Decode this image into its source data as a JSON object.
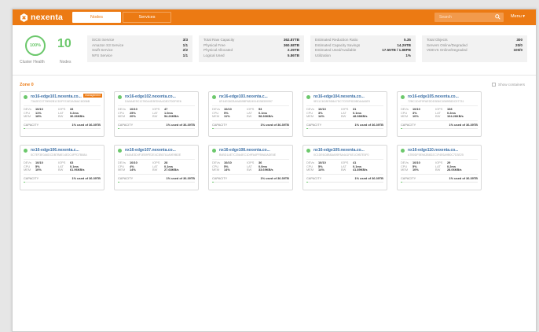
{
  "header": {
    "logo": "nexenta",
    "tabs": [
      {
        "label": "Nodes"
      },
      {
        "label": "Services"
      }
    ],
    "search_placeholder": "Search",
    "menu_label": "Menu ▾"
  },
  "summary": {
    "health_value": "100%",
    "health_label": "Cluster Health",
    "nodes_count": "10",
    "nodes_label": "Nodes",
    "services": [
      {
        "label": "iSCSI Service",
        "value": "3/3"
      },
      {
        "label": "Amazon S3 Service",
        "value": "1/1"
      },
      {
        "label": "Swift Service",
        "value": "2/2"
      },
      {
        "label": "NFS Service",
        "value": "1/1"
      }
    ],
    "capacity": [
      {
        "label": "Total Raw Capacity",
        "value": "362.87TB"
      },
      {
        "label": "Physical Free",
        "value": "360.58TB"
      },
      {
        "label": "Physical Allocated",
        "value": "2.29TB"
      },
      {
        "label": "Logical Used",
        "value": "5.86TB"
      }
    ],
    "efficiency": [
      {
        "label": "Estimated Reduction Ratio",
        "value": "5.35"
      },
      {
        "label": "Estimated Capacity Savings",
        "value": "14.29TB"
      },
      {
        "label": "Estimated Used/Available",
        "value": "17.55TB / 1.88PB"
      },
      {
        "label": "Utilization",
        "value": "1%"
      }
    ],
    "objects": [
      {
        "label": "Total Objects",
        "value": "300"
      },
      {
        "label": "Servers Online/Degraded",
        "value": "20/0"
      },
      {
        "label": "VDEVS Online/Degraded",
        "value": "100/0"
      }
    ]
  },
  "zone": {
    "title": "Zone 0",
    "show_containers_label": "Show containers"
  },
  "nodes": [
    {
      "name": "nx16-edge101.nexenta.co...",
      "id": "73A2EC3779B92B1CD2F07AE3A36AC8CB6B",
      "badge": "management",
      "devs": "10/10",
      "cpu": "11%",
      "mem": "18%",
      "iops": "33",
      "lat": "0.2ms",
      "bw": "36.36KB/s",
      "cap_label": "CAPACITY",
      "cap_value": "1% used of 36.39TB",
      "cap_pct": 1
    },
    {
      "name": "nx16-edge102.nexenta.co...",
      "id": "DA0A4E5C12780A4D3ED9A4C8D7DDF9E6",
      "badge": "",
      "devs": "10/10",
      "cpu": "25%",
      "mem": "20%",
      "iops": "47",
      "lat": "1.0ms",
      "bw": "54.26KB/s",
      "cap_label": "CAPACITY",
      "cap_value": "1% used of 36.39TB",
      "cap_pct": 1
    },
    {
      "name": "nx16-edge103.nexenta.c...",
      "id": "6F44E08CBA0AB9BF8824514D58300997",
      "badge": "",
      "devs": "10/10",
      "cpu": "5%",
      "mem": "11%",
      "iops": "53",
      "lat": "0.1ms",
      "bw": "58.36KB/s",
      "cap_label": "CAPACITY",
      "cap_value": "1% used of 36.39TB",
      "cap_pct": 1
    },
    {
      "name": "nx16-edge104.nexenta.co...",
      "id": "9E11C6C8E5D8A7DC7CE0F9D0BDA4A6E9",
      "badge": "",
      "devs": "10/10",
      "cpu": "3%",
      "mem": "14%",
      "iops": "31",
      "lat": "0.1ms",
      "bw": "48.98KB/s",
      "cap_label": "CAPACITY",
      "cap_value": "1% used of 36.39TB",
      "cap_pct": 1
    },
    {
      "name": "nx16-edge105.nexenta.co...",
      "id": "72BC1D4F9FAEDDD3B6C1B89E8DC57731",
      "badge": "",
      "devs": "10/10",
      "cpu": "3%",
      "mem": "10%",
      "iops": "108",
      "lat": "0.2ms",
      "bw": "104.26KB/s",
      "cap_label": "CAPACITY",
      "cap_value": "1% used of 36.39TB",
      "cap_pct": 1
    },
    {
      "name": "nx16-edge106.nexenta.c...",
      "id": "5C7EF3E0A6DCDB7B8E14E2C4FFD7B88A",
      "badge": "",
      "devs": "10/10",
      "cpu": "5%",
      "mem": "10%",
      "iops": "63",
      "lat": "0.1ms",
      "bw": "61.96KB/s",
      "cap_label": "CAPACITY",
      "cap_value": "1% used of 36.39TB",
      "cap_pct": 1
    },
    {
      "name": "nx16-edge107.nexenta.co...",
      "id": "E48AE3D4F1EB9FE2E4C3B07A1A9E9BDE",
      "badge": "",
      "devs": "10/10",
      "cpu": "4%",
      "mem": "14%",
      "iops": "28",
      "lat": "0.1ms",
      "bw": "27.68KB/s",
      "cap_label": "CAPACITY",
      "cap_value": "1% used of 36.39TB",
      "cap_pct": 1
    },
    {
      "name": "nx16-edge108.nexenta.co...",
      "id": "B4BD1AE7C20A4EC1D9FA4FFB9A5ADE6E",
      "badge": "",
      "devs": "10/10",
      "cpu": "5%",
      "mem": "14%",
      "iops": "36",
      "lat": "0.0ms",
      "bw": "33.69KB/s",
      "cap_label": "CAPACITY",
      "cap_value": "1% used of 36.39TB",
      "cap_pct": 1
    },
    {
      "name": "nx16-edge109.nexenta.co...",
      "id": "0C1DE6C8B8AA95F8A4A1F4E1C9B7E5F0",
      "badge": "",
      "devs": "10/10",
      "cpu": "5%",
      "mem": "14%",
      "iops": "41",
      "lat": "0.1ms",
      "bw": "41.89KB/s",
      "cap_label": "CAPACITY",
      "cap_value": "1% used of 36.39TB",
      "cap_pct": 1
    },
    {
      "name": "nx16-edge110.nexenta.co...",
      "id": "A7B0DF5E9A3B8D2C1F4E6A9B0C7D3E25",
      "badge": "",
      "devs": "10/10",
      "cpu": "5%",
      "mem": "10%",
      "iops": "29",
      "lat": "0.2ms",
      "bw": "28.06KB/s",
      "cap_label": "CAPACITY",
      "cap_value": "1% used of 36.39TB",
      "cap_pct": 1
    }
  ],
  "labels": {
    "devs": "DEVs",
    "cpu": "CPU",
    "mem": "MEM",
    "iops": "IOPS",
    "lat": "LAT",
    "bw": "BW"
  },
  "colors": {
    "accent": "#ec7a13",
    "ok": "#6cc86c",
    "link": "#3a6ea5"
  }
}
